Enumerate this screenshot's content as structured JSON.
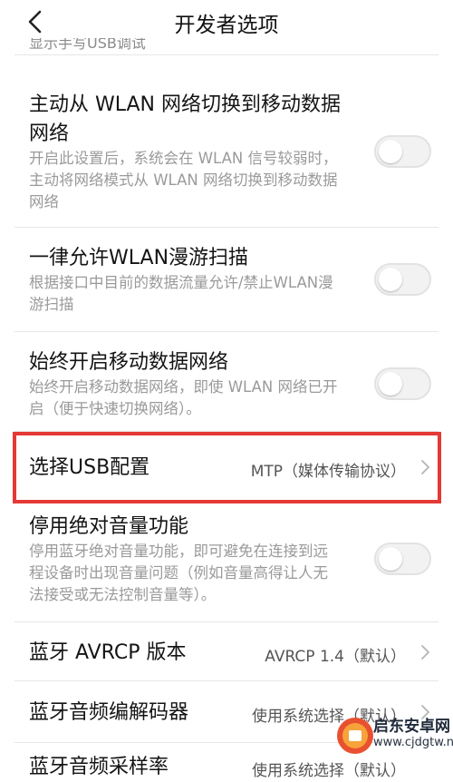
{
  "header": {
    "title": "开发者选项",
    "back_icon": "chevron-left-icon"
  },
  "cut_top_text": "显示手写USB调试",
  "settings": [
    {
      "title_line1": "主动从 WLAN 网络切换到移动数据",
      "title_line2": "网络",
      "desc_line1": "开启此设置后，系统会在 WLAN 信号较弱时，",
      "desc_line2": "主动将网络模式从 WLAN 网络切换到移动数据",
      "desc_line3": "网络",
      "toggle_on": false
    },
    {
      "title_line1": "一律允许WLAN漫游扫描",
      "desc_line1": "根据接口中目前的数据流量允许/禁止WLAN漫",
      "desc_line2": "游扫描",
      "toggle_on": false
    },
    {
      "title_line1": "始终开启移动数据网络",
      "desc_line1": "始终开启移动数据网络，即使 WLAN 网络已开",
      "desc_line2": "启（便于快速切换网络）。",
      "toggle_on": false
    },
    {
      "title_line1": "选择USB配置",
      "value": "MTP（媒体传输协议）"
    },
    {
      "title_line1": "停用绝对音量功能",
      "desc_line1": "停用蓝牙绝对音量功能，即可避免在连接到远",
      "desc_line2": "程设备时出现音量问题（例如音量高得让人无",
      "desc_line3": "法接受或无法控制音量等）。",
      "toggle_on": false
    },
    {
      "title_line1": "蓝牙 AVRCP 版本",
      "value": "AVRCP 1.4（默认）"
    },
    {
      "title_line1": "蓝牙音频编解码器",
      "value": "使用系统选择（默认）"
    },
    {
      "title_line1": "蓝牙音频采样率",
      "value": "使用系统选择（默认）"
    }
  ],
  "highlight_color": "#e53935",
  "watermark": {
    "name": "启东安卓网",
    "url": "www.cjdgtw.net"
  }
}
